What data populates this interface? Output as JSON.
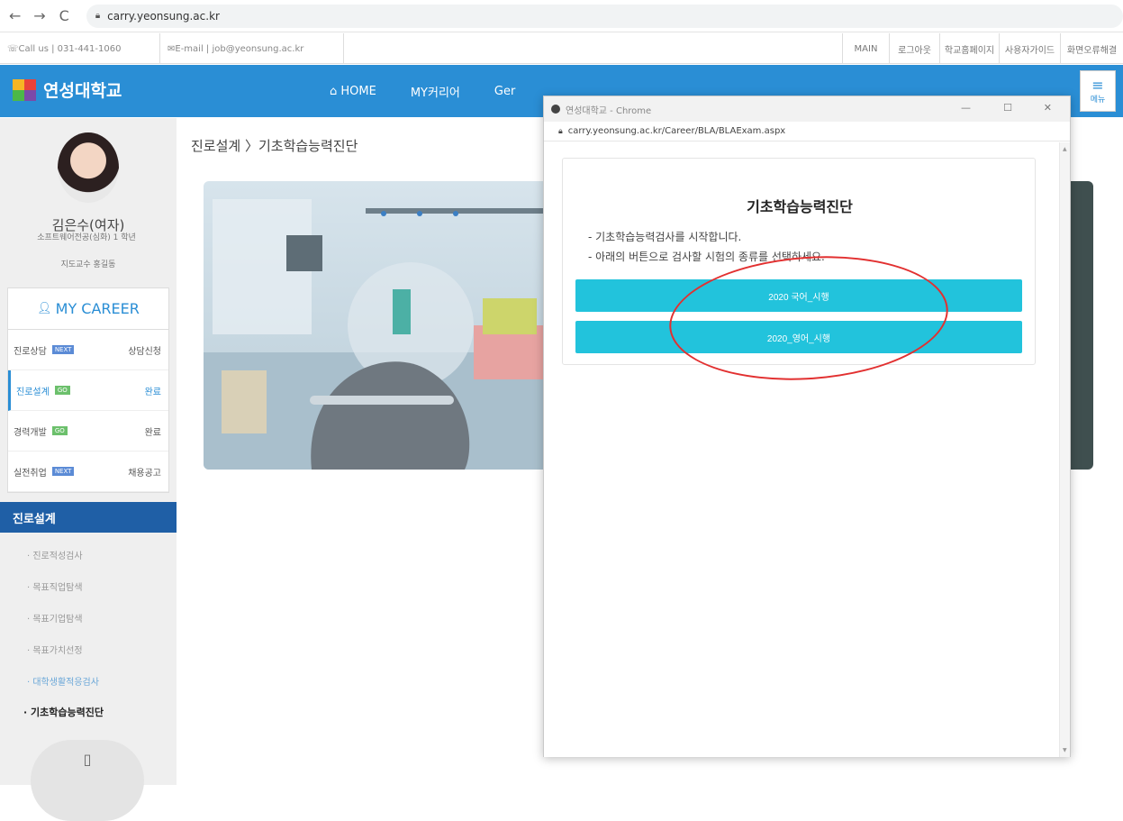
{
  "browser": {
    "back": "←",
    "forward": "→",
    "reload": "C",
    "url": "carry.yeonsung.ac.kr"
  },
  "util_bar": {
    "call": "☏Call us | 031-441-1060",
    "email": "✉E-mail | job@yeonsung.ac.kr",
    "links": [
      "MAIN",
      "로그아웃",
      "학교홈페이지",
      "사용자가이드",
      "화면오류해결"
    ]
  },
  "header": {
    "logo_text": "연성대학교",
    "nav": [
      "HOME",
      "MY커리어",
      "Ger",
      "",
      ""
    ],
    "menu_label": "메뉴"
  },
  "sidebar": {
    "name": "김은수(여자)",
    "dept": "소프트웨어전공(심화) 1 학년",
    "professor": "지도교수 홍길동",
    "career_title": "MY CAREER",
    "career_rows": [
      {
        "label": "진로상담",
        "tag": "NEXT",
        "status": "상담신청",
        "tag_color": "#5b8bd6"
      },
      {
        "label": "진로설계",
        "tag": "GO",
        "status": "완료",
        "tag_color": "#6cc06c"
      },
      {
        "label": "경력개발",
        "tag": "GO",
        "status": "완료",
        "tag_color": "#6cc06c"
      },
      {
        "label": "실전취업",
        "tag": "NEXT",
        "status": "채용공고",
        "tag_color": "#5b8bd6"
      }
    ],
    "section_title": "진로설계",
    "sub_items": [
      "· 진로적성검사",
      "· 목표직업탐색",
      "· 목표기업탐색",
      "· 목표가치선정",
      "· 대학생활적응검사",
      "· 기초학습능력진단"
    ]
  },
  "main": {
    "breadcrumb": "진로설계 〉기초학습능력진단"
  },
  "popup": {
    "window_title": "연성대학교 - Chrome",
    "url": "carry.yeonsung.ac.kr/Career/BLA/BLAExam.aspx",
    "exam_title": "기초학습능력진단",
    "desc_lines": [
      "- 기초학습능력검사를 시작합니다.",
      "- 아래의 버튼으로 검사할 시험의 종류를 선택하세요."
    ],
    "buttons": [
      "2020 국어_시행",
      "2020_영어_시행"
    ]
  }
}
